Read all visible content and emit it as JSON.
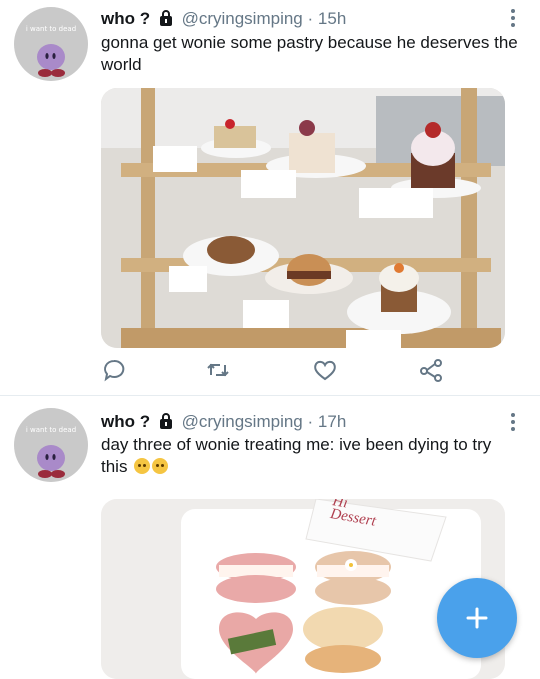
{
  "tweets": [
    {
      "name": "who ?",
      "handle": "@cryingsimping",
      "separator": "·",
      "time": "15h",
      "text": "gonna get wonie some pastry because he deserves the world",
      "avatar_caption": "i want to dead",
      "media_icon": "pastry-display-case-photo"
    },
    {
      "name": "who ?",
      "handle": "@cryingsimping",
      "separator": "·",
      "time": "17h",
      "text": "day three of wonie treating me:  ive been dying to try this",
      "emoji": [
        "pleading-face",
        "pleading-face"
      ],
      "avatar_caption": "i want to dead",
      "media_icon": "macaron-box-photo",
      "media_label": "Hi\nDessert"
    }
  ],
  "actions": [
    "reply-icon",
    "retweet-icon",
    "like-icon",
    "share-icon"
  ],
  "fab_icon": "compose-plus-icon",
  "colors": {
    "accent": "#4aa1eb",
    "secondary_text": "#657786",
    "primary_text": "#14171a"
  }
}
